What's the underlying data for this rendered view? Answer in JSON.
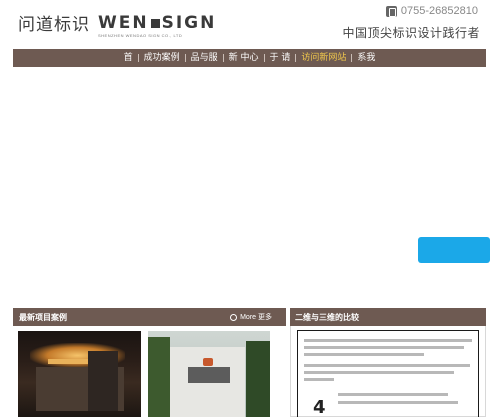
{
  "header": {
    "logo_cn": "问道标识",
    "logo_en_left": "WEN",
    "logo_en_right": "SIGN",
    "logo_en_sub": "SHENZHEN WENDAO SIGN CO., LTD",
    "phone": "0755-26852810",
    "slogan": "中国顶尖标识设计践行者"
  },
  "nav": {
    "items": [
      {
        "label": "首",
        "active": false
      },
      {
        "label": "成功案例",
        "active": false
      },
      {
        "label": "品与服",
        "active": false
      },
      {
        "label": "新 中心",
        "active": false
      },
      {
        "label": "于 请",
        "active": false
      },
      {
        "label": "访问新网站",
        "active": true
      },
      {
        "label": "系我",
        "active": false
      }
    ]
  },
  "projects": {
    "title": "最新项目案例",
    "more": "More 更多"
  },
  "compare": {
    "title": "二维与三维的比较",
    "graphic_text": "4"
  },
  "colors": {
    "nav_bg": "#6e5a52",
    "float_button": "#1ba8e8",
    "nav_active": "#f2c94c"
  }
}
